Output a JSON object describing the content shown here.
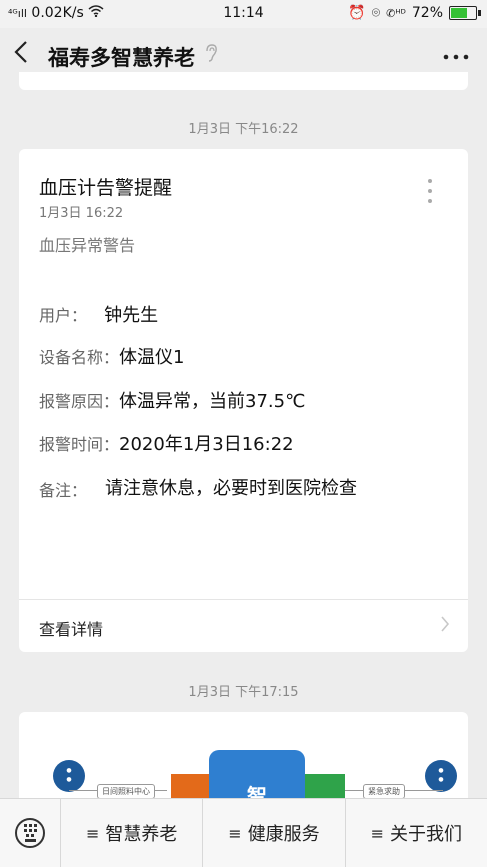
{
  "status_bar": {
    "signal": "⁴ᴳıll",
    "net_speed": "0.02K/s",
    "time": "11:14",
    "battery": "72%",
    "battery_level": 0.72
  },
  "nav": {
    "title": "福寿多智慧养老"
  },
  "messages": [
    {
      "timestamp": "1月3日 下午16:22",
      "card": {
        "title": "血压计告警提醒",
        "date": "1月3日  16:22",
        "subtitle": "血压异常警告",
        "fields": [
          {
            "label": "用户：",
            "value": "钟先生"
          },
          {
            "label": "设备名称：",
            "value": "体温仪1"
          },
          {
            "label": "报警原因：",
            "value": "体温异常，当前37.5℃"
          },
          {
            "label": "报警时间：",
            "value": "2020年1月3日16:22"
          },
          {
            "label": "备注：",
            "value": "请注意休息，必要时到医院检查"
          }
        ],
        "footer": "查看详情"
      }
    },
    {
      "timestamp": "1月3日 下午17:15",
      "image": {
        "center_char": "智",
        "left_label": "日间照料中心",
        "right_label": "紧急求助"
      }
    }
  ],
  "bottom_menu": [
    {
      "label": "智慧养老"
    },
    {
      "label": "健康服务"
    },
    {
      "label": "关于我们"
    }
  ],
  "colors": {
    "background": "#ededed",
    "battery_green": "#35c135"
  }
}
